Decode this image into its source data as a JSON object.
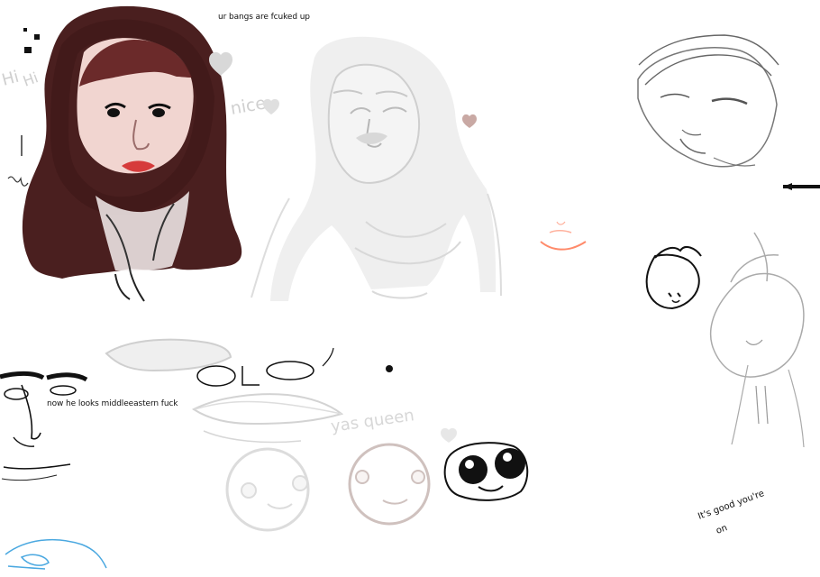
{
  "canvas": {
    "background": "#ffffff"
  },
  "comments": {
    "bangs": "ur bangs are fcuked up",
    "middle": "now he looks middleeastern fuck"
  },
  "scribbles": {
    "hi": "Hi",
    "hi_small": "Hi",
    "nice": "nice",
    "yas_queen": "yas queen",
    "good_line_1": "It's good you're",
    "good_line_2": "on"
  },
  "colors": {
    "hair_dark": "#4a1f1f",
    "hair_mid": "#6b2a2a",
    "skin": "#f1d5d0",
    "lips": "#d63b3b",
    "sketch_light": "#d8d8d8",
    "sketch_gray": "#c3c3c3",
    "ink": "#111111",
    "blue_line": "#4aa8e0",
    "pink_line": "#ff8a6a"
  }
}
